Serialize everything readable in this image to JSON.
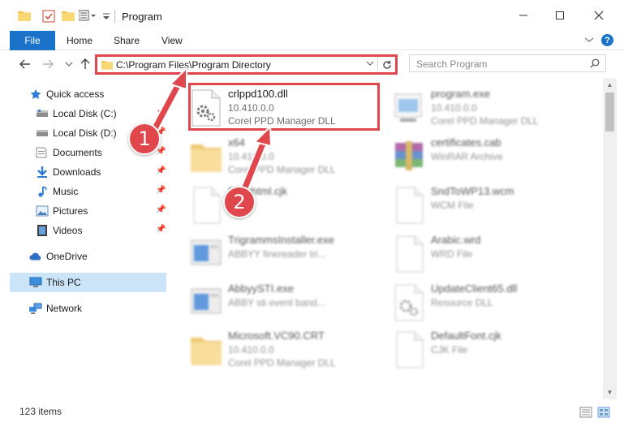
{
  "window": {
    "title": "Program",
    "controls": [
      "minimize-icon",
      "maximize-icon",
      "close-icon"
    ]
  },
  "ribbon": {
    "tabs": [
      {
        "label": "File",
        "active": true
      },
      {
        "label": "Home"
      },
      {
        "label": "Share"
      },
      {
        "label": "View"
      }
    ],
    "help_label": "?"
  },
  "navigation": {
    "address_path": "C:\\Program Files\\Program Directory",
    "search_placeholder": "Search Program"
  },
  "sidebar": {
    "items": [
      {
        "label": "Quick access",
        "icon": "star-icon"
      },
      {
        "label": "Local Disk (C:)",
        "icon": "drive-icon",
        "pinned": true
      },
      {
        "label": "Local Disk (D:)",
        "icon": "drive-icon",
        "pinned": true
      },
      {
        "label": "Documents",
        "icon": "documents-icon",
        "pinned": true
      },
      {
        "label": "Downloads",
        "icon": "downloads-icon",
        "pinned": true
      },
      {
        "label": "Music",
        "icon": "music-icon",
        "pinned": true
      },
      {
        "label": "Pictures",
        "icon": "pictures-icon",
        "pinned": true
      },
      {
        "label": "Videos",
        "icon": "videos-icon",
        "pinned": true
      },
      {
        "label": "OneDrive",
        "icon": "cloud-icon"
      },
      {
        "label": "This PC",
        "icon": "computer-icon",
        "selected": true
      },
      {
        "label": "Network",
        "icon": "network-icon"
      }
    ]
  },
  "files": [
    {
      "name": "crlppd100.dll",
      "line1": "10.410.0.0",
      "line2": "Corel PPD Manager DLL",
      "icon": "dll-gear-icon",
      "highlighted": true
    },
    {
      "name": "program.exe",
      "line1": "10.410.0.0",
      "line2": "Corel PPD Manager DLL",
      "icon": "exe-icon"
    },
    {
      "name": "x64",
      "line1": "10.410.0.0",
      "line2": "Corel PPD Manager DLL",
      "icon": "folder-icon"
    },
    {
      "name": "certificates.cab",
      "line1": "WinRAR Archive",
      "line2": "",
      "icon": "archive-icon"
    },
    {
      "name": "Errorhtml.cjk",
      "line1": "",
      "line2": "",
      "icon": "blank-file-icon"
    },
    {
      "name": "SndToWP13.wcm",
      "line1": "WCM File",
      "line2": "",
      "icon": "blank-file-icon"
    },
    {
      "name": "TrigrammsInstaller.exe",
      "line1": "ABBYY finereader tri...",
      "line2": "",
      "icon": "installer-icon"
    },
    {
      "name": "Arabic.wrd",
      "line1": "WRD File",
      "line2": "",
      "icon": "blank-file-icon"
    },
    {
      "name": "AbbyySTI.exe",
      "line1": "ABBY sti event band...",
      "line2": "",
      "icon": "installer-icon"
    },
    {
      "name": "UpdateClient65.dll",
      "line1": "Resource DLL",
      "line2": "",
      "icon": "dll-gear-icon"
    },
    {
      "name": "Microsoft.VC90.CRT",
      "line1": "10.410.0.0",
      "line2": "Corel PPD Manager DLL",
      "icon": "folder-icon"
    },
    {
      "name": "DefaultFont.cjk",
      "line1": "CJK File",
      "line2": "",
      "icon": "blank-file-icon"
    }
  ],
  "annotations": [
    {
      "label": "1"
    },
    {
      "label": "2"
    }
  ],
  "status": {
    "item_count": "123 items"
  },
  "colors": {
    "accent": "#1a73c8",
    "highlight": "#e0474c",
    "selected_bg": "#cce4f7"
  }
}
